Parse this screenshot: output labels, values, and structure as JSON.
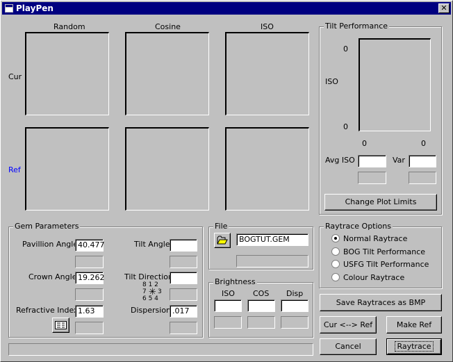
{
  "window": {
    "title": "PlayPen",
    "close_glyph": "✕"
  },
  "plots": {
    "columns": [
      "Random",
      "Cosine",
      "ISO"
    ],
    "rows": [
      "Cur",
      "Ref"
    ],
    "ref_color": "#0000ff"
  },
  "tilt_performance": {
    "legend": "Tilt Performance",
    "y_label": "ISO",
    "y_top": "0",
    "y_bottom": "0",
    "x_left": "0",
    "x_right": "0",
    "avg_iso_label": "Avg ISO",
    "avg_iso_value": "",
    "var_label": "Var",
    "var_value": "",
    "change_limits_label": "Change Plot Limits"
  },
  "gem_parameters": {
    "legend": "Gem Parameters",
    "pavilion_angle_label": "Pavillion Angle",
    "pavilion_angle_value": "40.477",
    "crown_angle_label": "Crown Angle",
    "crown_angle_value": "19.262",
    "refractive_index_label": "Refractive Index",
    "refractive_index_value": "1.63",
    "tilt_angle_label": "Tilt Angle",
    "tilt_angle_value": "",
    "tilt_direction_label": "Tilt Direction",
    "tilt_direction_value": "",
    "compass_top": "8 1 2",
    "compass_left": "7",
    "compass_right": "3",
    "compass_bottom": "6 5 4",
    "dispersion_label": "Dispersion",
    "dispersion_value": ".017"
  },
  "file": {
    "legend": "File",
    "filename": "BOGTUT.GEM",
    "open_icon": "folder-open-icon"
  },
  "brightness": {
    "legend": "Brightness",
    "iso_label": "ISO",
    "cos_label": "COS",
    "disp_label": "Disp"
  },
  "raytrace_options": {
    "legend": "Raytrace Options",
    "options": [
      "Normal Raytrace",
      "BOG Tilt Performance",
      "USFG Tilt Performance",
      "Colour Raytrace"
    ],
    "selected": "Normal Raytrace"
  },
  "buttons": {
    "save_bmp": "Save Raytraces as BMP",
    "cur_ref": "Cur <--> Ref",
    "make_ref": "Make Ref",
    "cancel": "Cancel",
    "raytrace": "Raytrace"
  }
}
